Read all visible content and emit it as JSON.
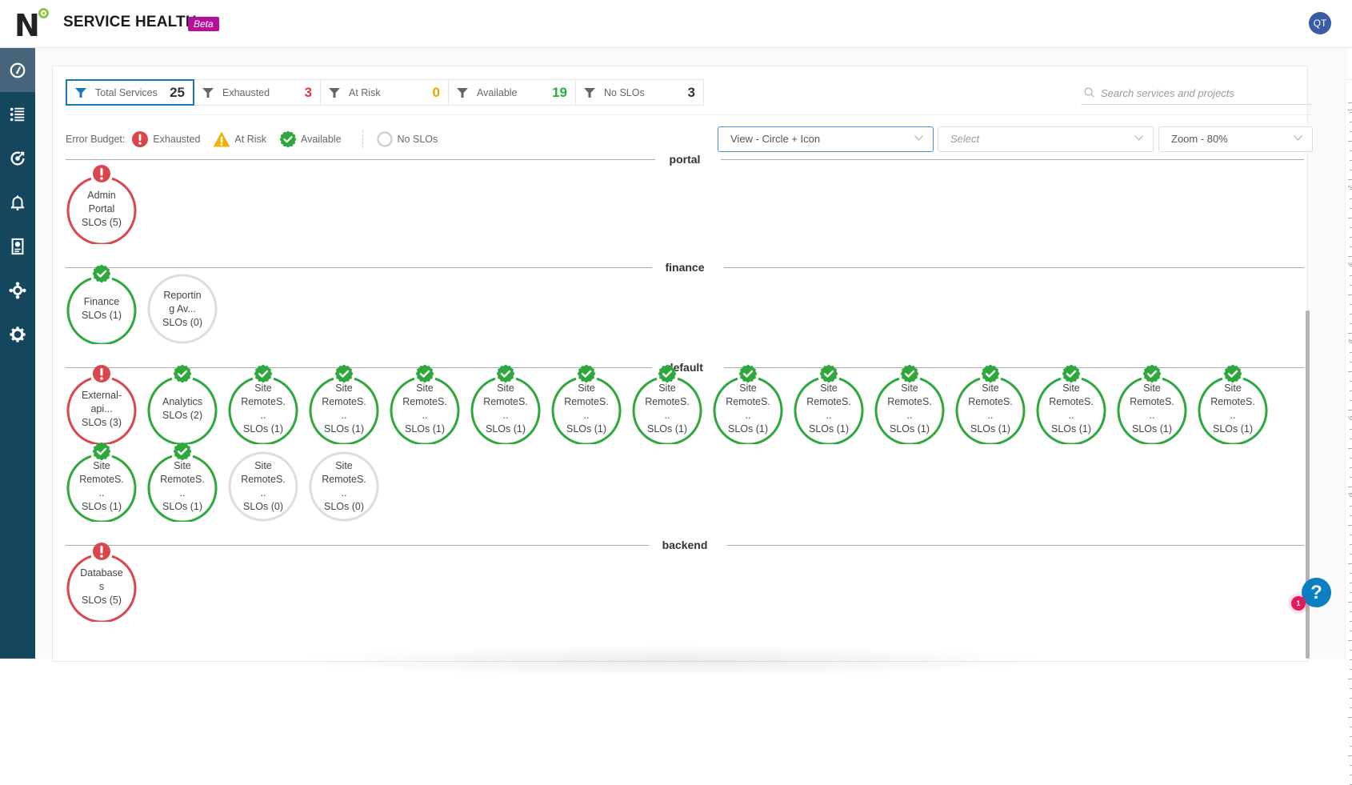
{
  "header": {
    "logo": "N",
    "title": "SERVICE HEALTH",
    "badge": "Beta",
    "user_initials": "QT"
  },
  "sidebar": {
    "items": [
      {
        "name": "dashboard",
        "icon": "speedometer-icon",
        "active": true
      },
      {
        "name": "list",
        "icon": "list-icon",
        "active": false
      },
      {
        "name": "slo",
        "icon": "target-refresh-icon",
        "active": false
      },
      {
        "name": "alerts",
        "icon": "bell-icon",
        "active": false
      },
      {
        "name": "reports",
        "icon": "report-icon",
        "active": false
      },
      {
        "name": "integrations",
        "icon": "integrations-icon",
        "active": false
      },
      {
        "name": "settings",
        "icon": "gear-icon",
        "active": false
      }
    ]
  },
  "filters": [
    {
      "label": "Total Services",
      "count": "25",
      "color": "#333333",
      "active": true
    },
    {
      "label": "Exhausted",
      "count": "3",
      "color": "#d93a3a",
      "active": false
    },
    {
      "label": "At Risk",
      "count": "0",
      "color": "#e8a200",
      "active": false
    },
    {
      "label": "Available",
      "count": "19",
      "color": "#2eaa3c",
      "active": false
    },
    {
      "label": "No SLOs",
      "count": "3",
      "color": "#333333",
      "active": false
    }
  ],
  "search": {
    "placeholder": "Search services and projects",
    "value": ""
  },
  "legend": {
    "label": "Error Budget:",
    "items": [
      {
        "label": "Exhausted",
        "icon": "exclamation-circle-icon"
      },
      {
        "label": "At Risk",
        "icon": "warning-triangle-icon"
      },
      {
        "label": "Available",
        "icon": "check-badge-icon"
      },
      {
        "label": "No SLOs",
        "icon": "empty-circle-icon"
      }
    ]
  },
  "dropdowns": {
    "view": "View - Circle + Icon",
    "select_placeholder": "Select",
    "zoom": "Zoom - 80%"
  },
  "colors": {
    "exhausted": "#d9474c",
    "at_risk": "#f0b20a",
    "available": "#2ea83c",
    "no_slos": "#dddddd",
    "accent": "#1877b8"
  },
  "sections": [
    {
      "name": "portal",
      "services": [
        {
          "lines": [
            "Admin",
            "Portal",
            "SLOs (5)"
          ],
          "status": "exhausted"
        }
      ]
    },
    {
      "name": "finance",
      "services": [
        {
          "lines": [
            "Finance",
            "SLOs (1)"
          ],
          "status": "available"
        },
        {
          "lines": [
            "Reportin",
            "g Av...",
            "SLOs (0)"
          ],
          "status": "none"
        }
      ]
    },
    {
      "name": "default",
      "services": [
        {
          "lines": [
            "External-",
            "api...",
            "SLOs (3)"
          ],
          "status": "exhausted"
        },
        {
          "lines": [
            "Analytics",
            "SLOs (2)"
          ],
          "status": "available"
        },
        {
          "lines": [
            "Site",
            "RemoteS.",
            "..",
            "SLOs (1)"
          ],
          "status": "available"
        },
        {
          "lines": [
            "Site",
            "RemoteS.",
            "..",
            "SLOs (1)"
          ],
          "status": "available"
        },
        {
          "lines": [
            "Site",
            "RemoteS.",
            "..",
            "SLOs (1)"
          ],
          "status": "available"
        },
        {
          "lines": [
            "Site",
            "RemoteS.",
            "..",
            "SLOs (1)"
          ],
          "status": "available"
        },
        {
          "lines": [
            "Site",
            "RemoteS.",
            "..",
            "SLOs (1)"
          ],
          "status": "available"
        },
        {
          "lines": [
            "Site",
            "RemoteS.",
            "..",
            "SLOs (1)"
          ],
          "status": "available"
        },
        {
          "lines": [
            "Site",
            "RemoteS.",
            "..",
            "SLOs (1)"
          ],
          "status": "available"
        },
        {
          "lines": [
            "Site",
            "RemoteS.",
            "..",
            "SLOs (1)"
          ],
          "status": "available"
        },
        {
          "lines": [
            "Site",
            "RemoteS.",
            "..",
            "SLOs (1)"
          ],
          "status": "available"
        },
        {
          "lines": [
            "Site",
            "RemoteS.",
            "..",
            "SLOs (1)"
          ],
          "status": "available"
        },
        {
          "lines": [
            "Site",
            "RemoteS.",
            "..",
            "SLOs (1)"
          ],
          "status": "available"
        },
        {
          "lines": [
            "Site",
            "RemoteS.",
            "..",
            "SLOs (1)"
          ],
          "status": "available"
        },
        {
          "lines": [
            "Site",
            "RemoteS.",
            "..",
            "SLOs (1)"
          ],
          "status": "available"
        },
        {
          "lines": [
            "Site",
            "RemoteS.",
            "..",
            "SLOs (1)"
          ],
          "status": "available"
        },
        {
          "lines": [
            "Site",
            "RemoteS.",
            "..",
            "SLOs (1)"
          ],
          "status": "available"
        },
        {
          "lines": [
            "Site",
            "RemoteS.",
            "..",
            "SLOs (0)"
          ],
          "status": "none"
        },
        {
          "lines": [
            "Site",
            "RemoteS.",
            "..",
            "SLOs (0)"
          ],
          "status": "none"
        }
      ]
    },
    {
      "name": "backend",
      "services": [
        {
          "lines": [
            "Database",
            "s",
            "SLOs (5)"
          ],
          "status": "exhausted"
        }
      ]
    }
  ],
  "ruler": {
    "labels": [
      "1",
      "2",
      "3",
      "4",
      "5",
      "6"
    ]
  },
  "help": {
    "label": "?",
    "notification_count": "1"
  }
}
